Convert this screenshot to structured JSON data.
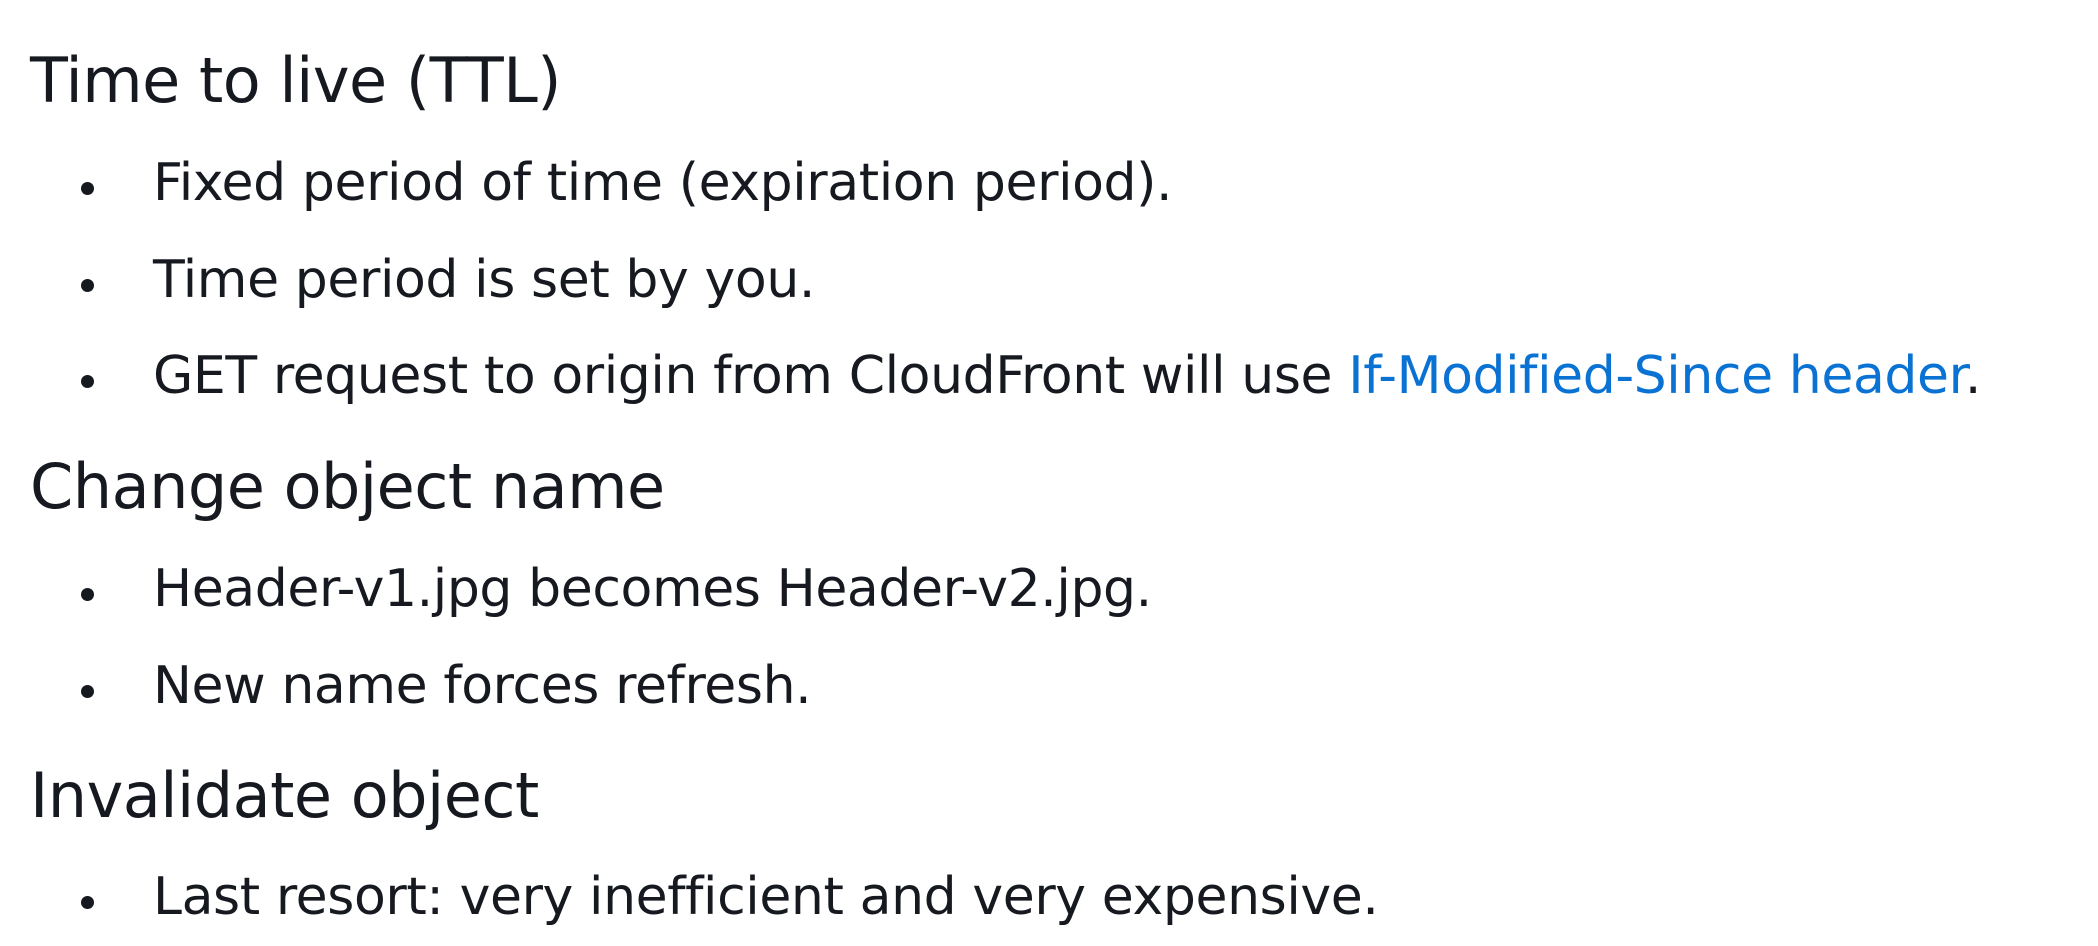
{
  "sections": [
    {
      "heading": "Time to live (TTL)",
      "items": [
        {
          "text": "Fixed period of time (expiration period)."
        },
        {
          "text": "Time period is set by you."
        },
        {
          "text_before": "GET request to origin from CloudFront will use ",
          "link": "If-Modified-Since header",
          "text_after": "."
        }
      ]
    },
    {
      "heading": "Change object name",
      "items": [
        {
          "text": "Header-v1.jpg becomes Header-v2.jpg."
        },
        {
          "text": "New name forces refresh."
        }
      ]
    },
    {
      "heading": "Invalidate object",
      "items": [
        {
          "text": "Last resort: very inefficient and very expensive."
        }
      ]
    }
  ],
  "colors": {
    "text": "#16191f",
    "link": "#0972d3"
  }
}
